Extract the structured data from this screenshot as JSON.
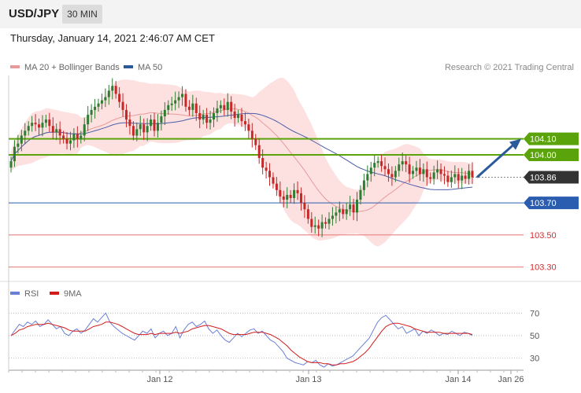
{
  "header": {
    "symbol": "USD/JPY",
    "timeframe": "30 MIN"
  },
  "timestamp": "Thursday, January 14, 2021 2:46:07 AM CET",
  "copyright": "Research © 2021 Trading Central",
  "colors": {
    "up_candle": "#2e7d32",
    "down_candle": "#c62828",
    "bollinger_band": "#fcd9d9",
    "ma20": "#e89a9a",
    "ma50": "#4a5ea8",
    "resistance": "#5aa30a",
    "support": "#2a5db0",
    "target_low": "#e57373",
    "current_price_tag": "#333333",
    "arrow": "#2a5a9a",
    "rsi": "#6a7fd6",
    "rsi_ma": "#d21c1c"
  },
  "chart_data": [
    {
      "type": "candlestick",
      "name": "price",
      "legend": [
        {
          "label": "MA 20 + Bollinger Bands",
          "color": "#e89a9a"
        },
        {
          "label": "MA 50",
          "color": "#2a5a9a"
        }
      ],
      "legend_placement": "top-left",
      "ylim": [
        103.22,
        104.5
      ],
      "levels": [
        {
          "value": 104.1,
          "label": "104.10",
          "kind": "resistance"
        },
        {
          "value": 104.0,
          "label": "104.00",
          "kind": "resistance"
        },
        {
          "value": 103.86,
          "label": "103.86",
          "kind": "current"
        },
        {
          "value": 103.7,
          "label": "103.70",
          "kind": "support"
        },
        {
          "value": 103.5,
          "label": "103.50",
          "kind": "target_low"
        },
        {
          "value": 103.3,
          "label": "103.30",
          "kind": "target_low"
        }
      ],
      "x_ticks": [
        "Jan 12",
        "Jan 13",
        "Jan 14",
        "Jan 26"
      ],
      "close": [
        103.96,
        104.05,
        104.07,
        104.12,
        104.15,
        104.18,
        104.2,
        104.19,
        104.17,
        104.2,
        104.22,
        104.18,
        104.14,
        104.16,
        104.12,
        104.1,
        104.07,
        104.09,
        104.13,
        104.1,
        104.12,
        104.19,
        104.25,
        104.28,
        104.3,
        104.32,
        104.34,
        104.36,
        104.4,
        104.43,
        104.38,
        104.33,
        104.28,
        104.22,
        104.18,
        104.12,
        104.16,
        104.19,
        104.14,
        104.18,
        104.22,
        104.15,
        104.2,
        104.24,
        104.28,
        104.31,
        104.32,
        104.34,
        104.36,
        104.38,
        104.3,
        104.28,
        104.32,
        104.26,
        104.22,
        104.25,
        104.2,
        104.22,
        104.26,
        104.29,
        104.31,
        104.28,
        104.33,
        104.27,
        104.23,
        104.25,
        104.21,
        104.19,
        104.15,
        104.1,
        104.06,
        103.98,
        103.92,
        103.9,
        103.86,
        103.82,
        103.78,
        103.74,
        103.72,
        103.75,
        103.73,
        103.78,
        103.76,
        103.7,
        103.66,
        103.6,
        103.55,
        103.56,
        103.54,
        103.58,
        103.57,
        103.6,
        103.62,
        103.64,
        103.66,
        103.63,
        103.66,
        103.69,
        103.64,
        103.72,
        103.78,
        103.84,
        103.88,
        103.92,
        103.95,
        103.96,
        103.93,
        103.91,
        103.88,
        103.86,
        103.9,
        103.94,
        103.96,
        103.94,
        103.88,
        103.9,
        103.92,
        103.88,
        103.91,
        103.86,
        103.85,
        103.89,
        103.91,
        103.88,
        103.87,
        103.83,
        103.86,
        103.88,
        103.84,
        103.87,
        103.85,
        103.9,
        103.86
      ],
      "rsi": {
        "ylim": [
          20,
          80
        ],
        "ticks": [
          70,
          50,
          30
        ],
        "legend": [
          {
            "label": "RSI",
            "color": "#6a7fd6"
          },
          {
            "label": "9MA",
            "color": "#d21c1c"
          }
        ],
        "rsi_values": [
          50,
          55,
          60,
          58,
          62,
          60,
          63,
          58,
          60,
          64,
          60,
          56,
          58,
          52,
          50,
          54,
          56,
          52,
          55,
          60,
          65,
          62,
          66,
          70,
          62,
          58,
          55,
          52,
          50,
          48,
          46,
          50,
          54,
          52,
          56,
          48,
          52,
          54,
          50,
          52,
          58,
          48,
          55,
          60,
          62,
          58,
          60,
          63,
          56,
          52,
          55,
          50,
          46,
          44,
          48,
          52,
          49,
          52,
          55,
          56,
          52,
          54,
          50,
          46,
          44,
          40,
          36,
          30,
          28,
          26,
          25,
          24,
          27,
          26,
          28,
          24,
          22,
          25,
          23,
          24,
          26,
          28,
          30,
          32,
          36,
          40,
          44,
          48,
          55,
          62,
          66,
          68,
          64,
          60,
          56,
          58,
          52,
          54,
          56,
          50,
          54,
          52,
          55,
          53,
          50,
          52,
          51,
          54,
          52,
          50,
          53,
          52,
          50
        ],
        "ma_values": [
          50,
          52,
          55,
          56,
          58,
          59,
          60,
          60,
          60,
          61,
          60,
          59,
          58,
          57,
          55,
          54,
          54,
          54,
          54,
          56,
          58,
          59,
          60,
          62,
          62,
          61,
          60,
          58,
          56,
          54,
          52,
          51,
          51,
          51,
          52,
          51,
          52,
          52,
          52,
          52,
          53,
          52,
          53,
          54,
          56,
          57,
          58,
          59,
          59,
          58,
          57,
          56,
          54,
          52,
          51,
          51,
          51,
          51,
          52,
          53,
          53,
          53,
          52,
          51,
          49,
          47,
          44,
          41,
          37,
          34,
          31,
          29,
          27,
          26,
          26,
          26,
          25,
          25,
          24,
          24,
          25,
          25,
          26,
          27,
          29,
          32,
          35,
          39,
          44,
          49,
          54,
          58,
          60,
          61,
          61,
          60,
          59,
          58,
          56,
          55,
          54,
          53,
          53,
          53,
          53,
          52,
          52,
          52,
          52,
          52,
          52,
          52,
          51
        ]
      }
    }
  ]
}
